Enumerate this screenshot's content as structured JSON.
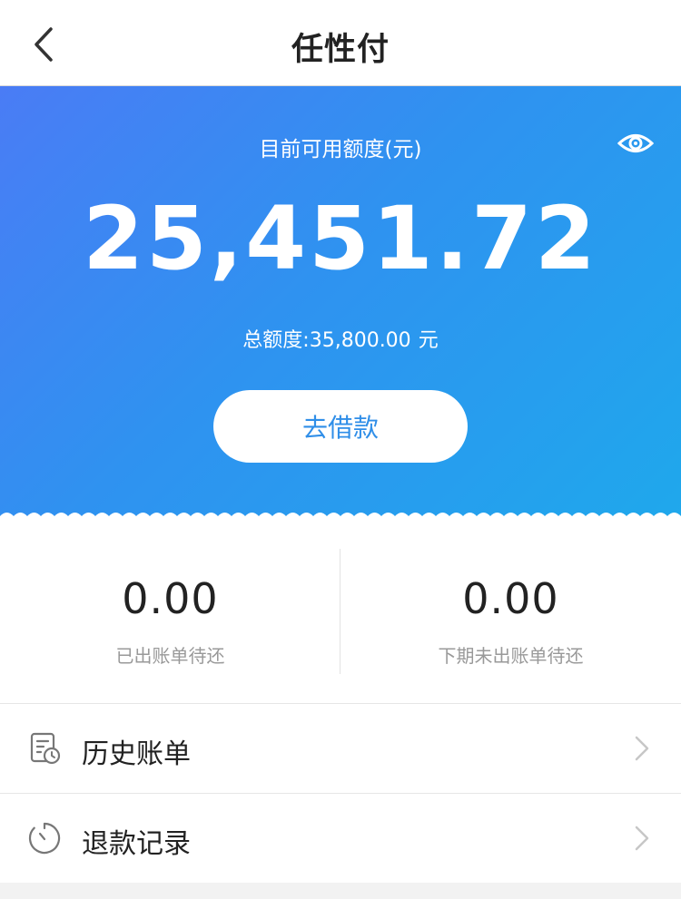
{
  "header": {
    "title": "任性付",
    "back_icon": "chevron-left-icon"
  },
  "credit": {
    "available_label": "目前可用额度(元)",
    "available_amount": "25,451.72",
    "total_label": "总额度:35,800.00",
    "total_unit": "元",
    "eye_icon": "eye-icon",
    "borrow_button": "去借款"
  },
  "summary": {
    "billed": {
      "value": "0.00",
      "label": "已出账单待还"
    },
    "unbilled": {
      "value": "0.00",
      "label": "下期未出账单待还"
    }
  },
  "menu": [
    {
      "label": "历史账单",
      "icon": "bill-history-icon"
    },
    {
      "label": "退款记录",
      "icon": "clock-icon"
    }
  ],
  "colors": {
    "gradient_start": "#4a7cf5",
    "gradient_end": "#1fa8ec",
    "button_text": "#2f8ee8"
  }
}
